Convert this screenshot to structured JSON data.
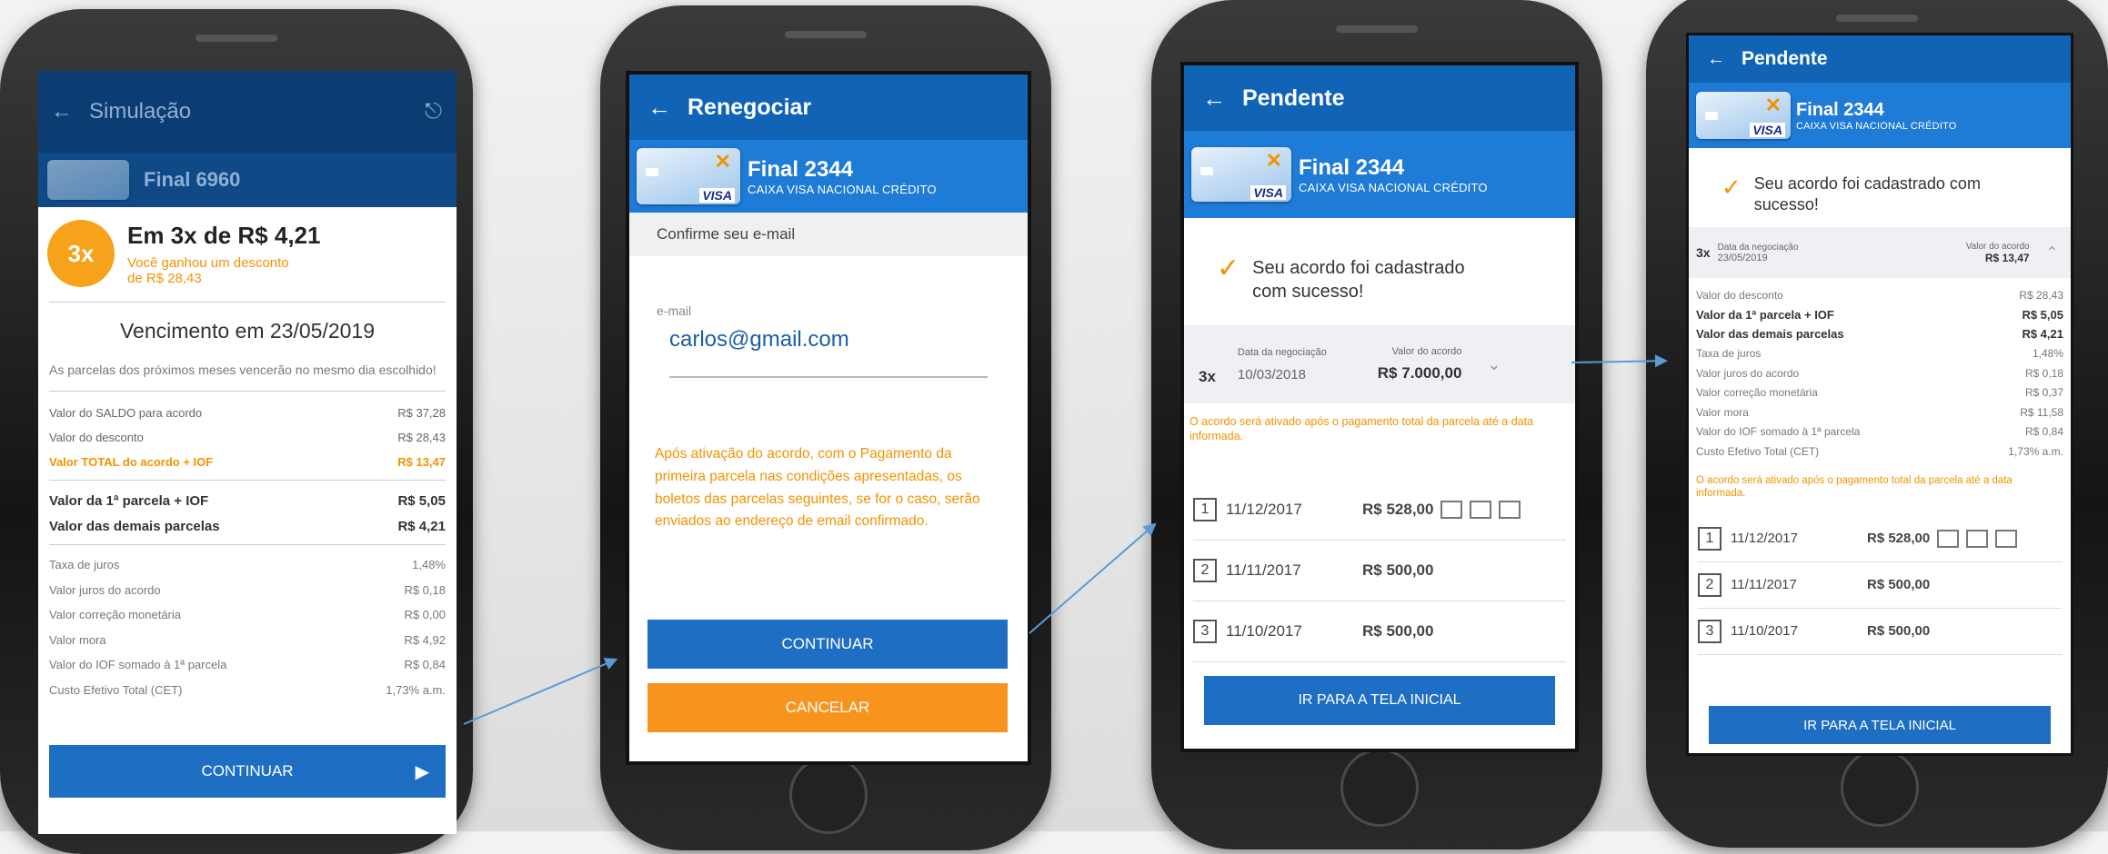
{
  "screen1": {
    "header_title": "Simulação",
    "card_final": "Final 6960",
    "badge": "3x",
    "offer_title": "Em 3x de R$ 4,21",
    "discount_line1": "Você ganhou um desconto",
    "discount_line2": "de R$ 28,43",
    "due": "Vencimento em 23/05/2019",
    "note": "As parcelas dos próximos meses vencerão no mesmo dia escolhido!",
    "rows_a": [
      {
        "label": "Valor do SALDO para acordo",
        "value": "R$ 37,28"
      },
      {
        "label": "Valor do desconto",
        "value": "R$ 28,43"
      },
      {
        "label": "Valor TOTAL do acordo + IOF",
        "value": "R$ 13,47"
      }
    ],
    "rows_b": [
      {
        "label": "Valor da 1ª parcela + IOF",
        "value": "R$ 5,05"
      },
      {
        "label": "Valor das demais parcelas",
        "value": "R$ 4,21"
      }
    ],
    "rows_c": [
      {
        "label": "Taxa de juros",
        "value": "1,48%"
      },
      {
        "label": "Valor juros do acordo",
        "value": "R$ 0,18"
      },
      {
        "label": "Valor correção monetária",
        "value": "R$ 0,00"
      },
      {
        "label": "Valor mora",
        "value": "R$ 4,92"
      },
      {
        "label": "Valor do IOF somado à 1ª parcela",
        "value": "R$ 0,84"
      },
      {
        "label": "Custo Efetivo Total (CET)",
        "value": "1,73% a.m."
      }
    ],
    "continue": "CONTINUAR"
  },
  "screen2": {
    "header_title": "Renegociar",
    "card_final": "Final 2344",
    "bank": "CAIXA VISA NACIONAL CRÉDITO",
    "confirm_label": "Confirme seu e-mail",
    "email_label": "e-mail",
    "email_value": "carlos@gmail.com",
    "info": "Após ativação do acordo, com o Pagamento da primeira parcela nas condições apresentadas, os boletos das parcelas seguintes, se for o caso, serão enviados ao endereço de email confirmado.",
    "continue": "CONTINUAR",
    "cancel": "CANCELAR"
  },
  "screen3": {
    "header_title": "Pendente",
    "card_final": "Final 2344",
    "bank": "CAIXA VISA NACIONAL CRÉDITO",
    "success": "Seu acordo foi cadastrado com sucesso!",
    "installments": "3x",
    "date_label": "Data da negociação",
    "date_value": "10/03/2018",
    "amount_label": "Valor do acordo",
    "amount_value": "R$ 7.000,00",
    "warning": "O acordo será ativado após o pagamento total da parcela até a data informada.",
    "parcelas": [
      {
        "n": "1",
        "date": "11/12/2017",
        "value": "R$ 528,00"
      },
      {
        "n": "2",
        "date": "11/11/2017",
        "value": "R$ 500,00"
      },
      {
        "n": "3",
        "date": "11/10/2017",
        "value": "R$ 500,00"
      }
    ],
    "home_button": "IR PARA A TELA INICIAL"
  },
  "screen4": {
    "header_title": "Pendente",
    "card_final": "Final 2344",
    "bank": "CAIXA VISA NACIONAL CRÉDITO",
    "success": "Seu acordo foi cadastrado com sucesso!",
    "installments": "3x",
    "date_label": "Data da negociação",
    "date_value": "23/05/2019",
    "amount_label": "Valor do acordo",
    "amount_value": "R$ 13,47",
    "rows": [
      {
        "label": "Valor do desconto",
        "value": "R$ 28,43",
        "bold": false
      },
      {
        "label": "Valor da 1ª parcela + IOF",
        "value": "R$ 5,05",
        "bold": true
      },
      {
        "label": "Valor das demais parcelas",
        "value": "R$ 4,21",
        "bold": true
      },
      {
        "label": "Taxa de juros",
        "value": "1,48%",
        "bold": false
      },
      {
        "label": "Valor juros do acordo",
        "value": "R$ 0,18",
        "bold": false
      },
      {
        "label": "Valor correção monetária",
        "value": "R$ 0,37",
        "bold": false
      },
      {
        "label": "Valor mora",
        "value": "R$ 11,58",
        "bold": false
      },
      {
        "label": "Valor do IOF somado à 1ª parcela",
        "value": "R$ 0,84",
        "bold": false
      },
      {
        "label": "Custo Efetivo Total (CET)",
        "value": "1,73% a.m.",
        "bold": false
      }
    ],
    "warning": "O acordo será ativado após o pagamento total da parcela até a data informada.",
    "parcelas": [
      {
        "n": "1",
        "date": "11/12/2017",
        "value": "R$ 528,00"
      },
      {
        "n": "2",
        "date": "11/11/2017",
        "value": "R$ 500,00"
      },
      {
        "n": "3",
        "date": "11/10/2017",
        "value": "R$ 500,00"
      }
    ],
    "home_button": "IR PARA A TELA INICIAL"
  },
  "colors": {
    "brand_blue": "#1063b5",
    "accent_orange": "#f7941d",
    "flow_arrow": "#5b9bd5"
  }
}
